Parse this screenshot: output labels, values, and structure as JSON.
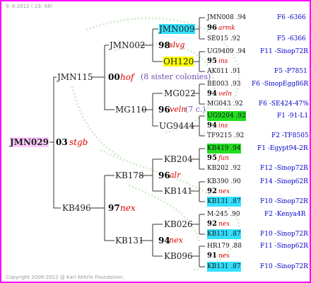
{
  "header_stamp": "9. 6-2012 ( 23: 58)",
  "copyright": "Copyright 2008-2012 @ Karl Kehrle Foundation.",
  "root": {
    "name": "JMN029",
    "year": "03",
    "breed": "stgb"
  },
  "gen1": [
    {
      "name": "JMN115",
      "year": "00",
      "breed": "hof",
      "note": "(8 sister colonies)"
    },
    {
      "name": "KB496",
      "year": "97",
      "breed": "nex"
    }
  ],
  "gen2": [
    {
      "name": "JMN002",
      "year": "98",
      "breed": "slvg"
    },
    {
      "name": "MG110",
      "year": "96",
      "breed": "veln",
      "note": "(7 c.)"
    },
    {
      "name": "KB178",
      "year": "96",
      "breed": "alr"
    },
    {
      "name": "KB131",
      "year": "94",
      "breed": "nex"
    }
  ],
  "gen3": [
    "JMN009",
    "OH120",
    "MG022",
    "UG9444",
    "KB204",
    "KB141",
    "KB026",
    "KB096"
  ],
  "gen4": [
    {
      "upper": {
        "name": "JMN008",
        "val": ".94"
      },
      "year": "96",
      "breed": "armk",
      "lower": {
        "name": "SE015",
        "val": ".92"
      },
      "id_upper": "F6 -6366",
      "id_lower": "F5 -6366"
    },
    {
      "upper": {
        "name": "UG9409",
        "val": ".94"
      },
      "year": "95",
      "breed": "ins",
      "lower": {
        "name": "AK011",
        "val": ".91"
      },
      "id_upper": "F11 -Sinop72R",
      "id_lower": "F5 -P7851"
    },
    {
      "upper": {
        "name": "BE003",
        "val": ".93"
      },
      "year": "94",
      "breed": "veln",
      "lower": {
        "name": "MG043",
        "val": ".92"
      },
      "id_upper": "F6 -SinopEgg86R",
      "id_lower": "F6 -SE424-47%"
    },
    {
      "upper": {
        "name": "UG9204",
        "val": ".92"
      },
      "year": "94",
      "breed": "ins",
      "lower": {
        "name": "TF9215",
        "val": ".92"
      },
      "id_upper": "F1 -91-L1",
      "id_lower": "F2 -TF8505"
    },
    {
      "upper": {
        "name": "KB419",
        "val": ".94"
      },
      "year": "95",
      "breed": "fun",
      "lower": {
        "name": "KB202",
        "val": ".92"
      },
      "id_upper": "F1 -Egypt94-2R",
      "id_lower": "F12 -Sinop72R"
    },
    {
      "upper": {
        "name": "KB390",
        "val": ".90"
      },
      "year": "92",
      "breed": "nex",
      "lower": {
        "name": "KB131",
        "val": ".87"
      },
      "id_upper": "F14 -Sinop62R",
      "id_lower": "F10 -Sinop72R"
    },
    {
      "upper": {
        "name": "M-245",
        "val": ".90"
      },
      "year": "92",
      "breed": "nex",
      "lower": {
        "name": "KB131",
        "val": ".87"
      },
      "id_upper": "F2 -Kenya4R",
      "id_lower": "F10 -Sinop72R"
    },
    {
      "upper": {
        "name": "HR179",
        "val": ".88"
      },
      "year": "91",
      "breed": "nex",
      "lower": {
        "name": "KB131",
        "val": ".87"
      },
      "id_upper": "F11 -Sinop62R",
      "id_lower": "F10 -Sinop72R"
    }
  ],
  "colors": {
    "frame": "#ff00ff",
    "breed": "#dd0000",
    "id": "#0000cc",
    "highlight_cyan": "#33e0ff",
    "highlight_yellow": "#ffff00",
    "highlight_green": "#22dd22",
    "root_bg": "#ffccff"
  }
}
